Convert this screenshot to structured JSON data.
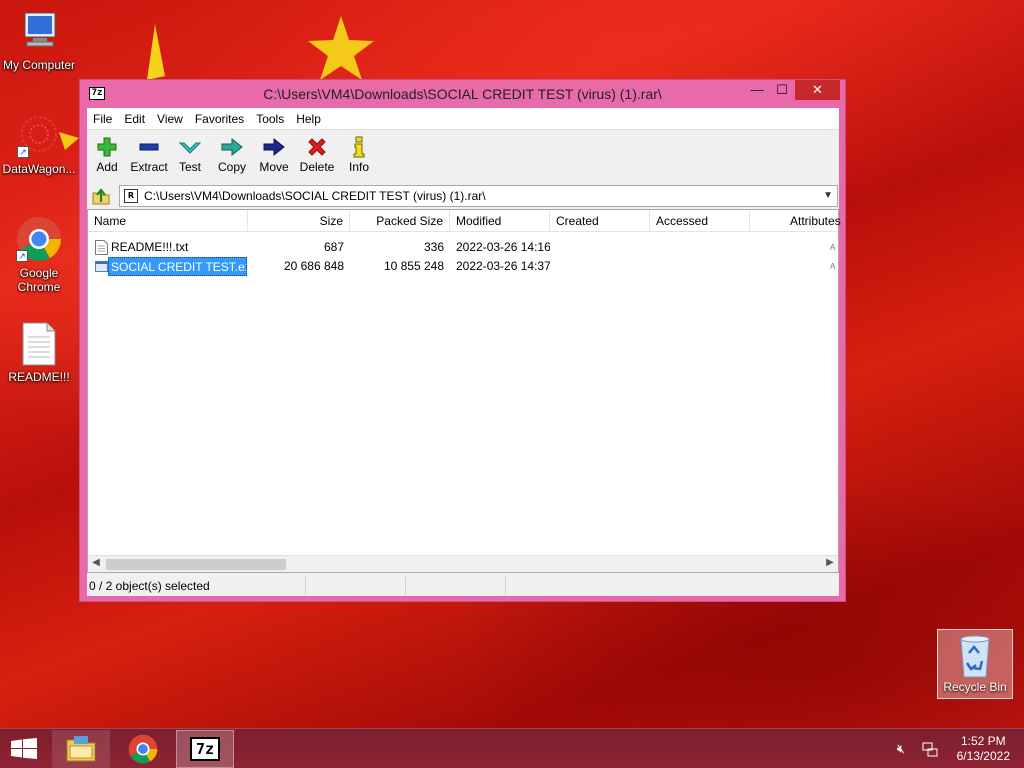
{
  "desktop": {
    "icons": [
      {
        "label": "My Computer"
      },
      {
        "label": "DataWagon..."
      },
      {
        "label": "Google Chrome"
      },
      {
        "label": "README!!!"
      }
    ],
    "recycle_bin": "Recycle Bin"
  },
  "window": {
    "title": "C:\\Users\\VM4\\Downloads\\SOCIAL CREDIT TEST (virus) (1).rar\\",
    "app_icon": "7z",
    "controls": {
      "minimize": "—",
      "maximize": "☐",
      "close": "✕"
    },
    "menu": [
      "File",
      "Edit",
      "View",
      "Favorites",
      "Tools",
      "Help"
    ],
    "toolbar": [
      {
        "label": "Add",
        "icon": "plus-icon"
      },
      {
        "label": "Extract",
        "icon": "minus-icon"
      },
      {
        "label": "Test",
        "icon": "check-icon"
      },
      {
        "label": "Copy",
        "icon": "copy-arrow-icon"
      },
      {
        "label": "Move",
        "icon": "move-arrow-icon"
      },
      {
        "label": "Delete",
        "icon": "x-icon"
      },
      {
        "label": "Info",
        "icon": "info-icon"
      }
    ],
    "address": "C:\\Users\\VM4\\Downloads\\SOCIAL CREDIT TEST (virus) (1).rar\\",
    "columns": [
      "Name",
      "Size",
      "Packed Size",
      "Modified",
      "Created",
      "Accessed",
      "Attributes"
    ],
    "files": [
      {
        "name": "README!!!.txt",
        "size": "687",
        "packed": "336",
        "modified": "2022-03-26 14:16",
        "attr": "A"
      },
      {
        "name": "SOCIAL CREDIT TEST.exe",
        "size": "20 686 848",
        "packed": "10 855 248",
        "modified": "2022-03-26 14:37",
        "attr": "A"
      }
    ],
    "status": "0 / 2 object(s) selected"
  },
  "taskbar": {
    "time": "1:52 PM",
    "date": "6/13/2022",
    "active_app": "7z"
  },
  "colors": {
    "window_frame": "#e86aa9",
    "selection": "#3399ff",
    "close_button": "#c7282b",
    "taskbar": "#8e2334"
  }
}
